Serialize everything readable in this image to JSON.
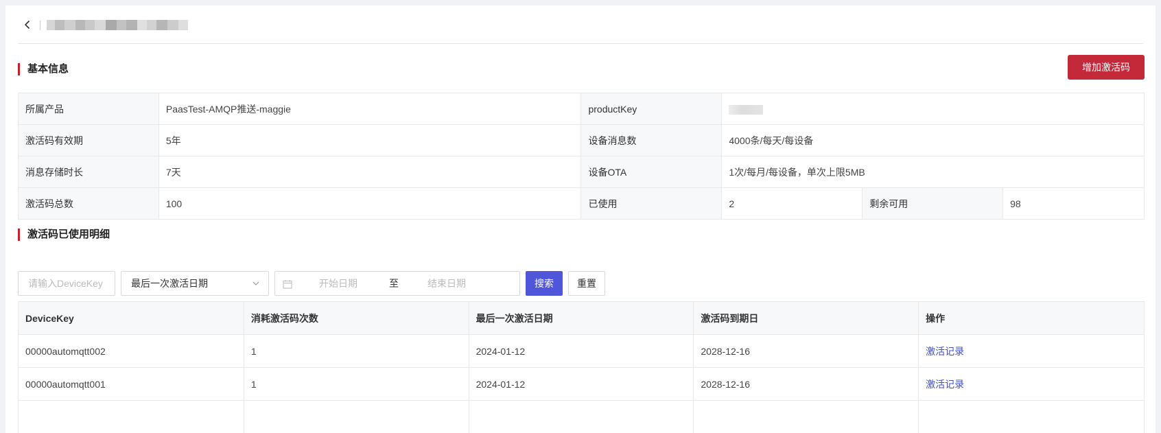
{
  "header": {
    "back_icon": "chevron-left-icon",
    "title_obscured": true
  },
  "basic_info": {
    "title": "基本信息",
    "add_button_label": "增加激活码",
    "accent_color": "#c4293a",
    "rows": [
      {
        "label1": "所属产品",
        "value1": "PaasTest-AMQP推送-maggie",
        "label2": "productKey",
        "value2": ""
      },
      {
        "label1": "激活码有效期",
        "value1": "5年",
        "label2": "设备消息数",
        "value2": "4000条/每天/每设备"
      },
      {
        "label1": "消息存储时长",
        "value1": "7天",
        "label2": "设备OTA",
        "value2": "1次/每月/每设备，单次上限5MB"
      },
      {
        "label1": "激活码总数",
        "value1": "100",
        "label2": "已使用",
        "value2": "2",
        "label3": "剩余可用",
        "value3": "98"
      }
    ]
  },
  "usage_detail": {
    "title": "激活码已使用明细",
    "filter": {
      "devicekey_placeholder": "请输入DeviceKey",
      "date_type_selected": "最后一次激活日期",
      "start_placeholder": "开始日期",
      "range_separator": "至",
      "end_placeholder": "结束日期",
      "search_label": "搜索",
      "reset_label": "重置",
      "search_color": "#4f56d9"
    },
    "columns": [
      "DeviceKey",
      "消耗激活码次数",
      "最后一次激活日期",
      "激活码到期日",
      "操作"
    ],
    "rows": [
      {
        "devicekey": "00000automqtt002",
        "count": "1",
        "last_activation": "2024-01-12",
        "expiry": "2028-12-16",
        "action": "激活记录"
      },
      {
        "devicekey": "00000automqtt001",
        "count": "1",
        "last_activation": "2024-01-12",
        "expiry": "2028-12-16",
        "action": "激活记录"
      }
    ]
  }
}
